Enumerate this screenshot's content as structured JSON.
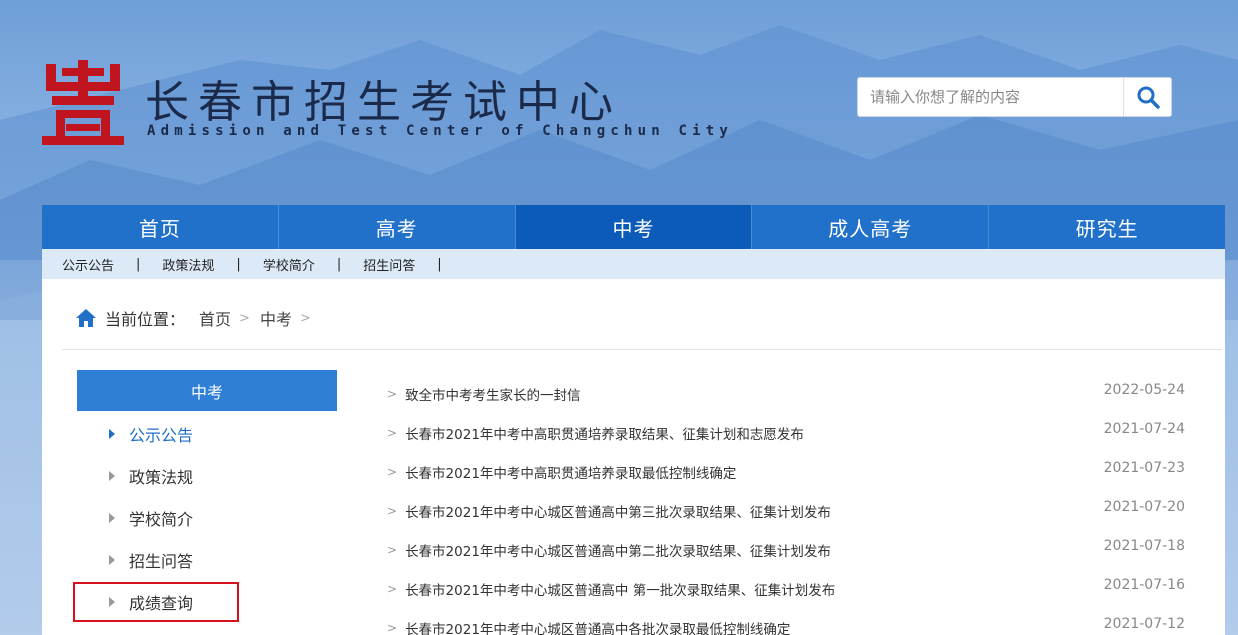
{
  "header": {
    "logo_icon": "changchun-logo-icon",
    "title": "长春市招生考试中心",
    "subtitle": "Admission and Test Center of Changchun City",
    "brand_color": "#c0151e"
  },
  "search": {
    "placeholder": "请输入你想了解的内容",
    "value": "",
    "button_icon": "search-icon"
  },
  "nav": {
    "items": [
      {
        "label": "首页"
      },
      {
        "label": "高考"
      },
      {
        "label": "中考"
      },
      {
        "label": "成人高考"
      },
      {
        "label": "研究生"
      }
    ],
    "active": "中考",
    "color": "#2170c9"
  },
  "subnav": {
    "items": [
      {
        "label": "公示公告"
      },
      {
        "label": "政策法规"
      },
      {
        "label": "学校简介"
      },
      {
        "label": "招生问答"
      }
    ],
    "separator": "|"
  },
  "breadcrumb": {
    "icon": "home-icon",
    "prefix": "当前位置：",
    "items": [
      {
        "label": "首页"
      },
      {
        "label": "中考"
      }
    ],
    "separator": ">"
  },
  "sidebar": {
    "header": "中考",
    "items": [
      {
        "label": "公示公告",
        "active": true
      },
      {
        "label": "政策法规",
        "active": false
      },
      {
        "label": "学校简介",
        "active": false
      },
      {
        "label": "招生问答",
        "active": false
      },
      {
        "label": "成绩查询",
        "active": false,
        "highlighted": true
      }
    ]
  },
  "news": {
    "items": [
      {
        "title": "致全市中考考生家长的一封信",
        "date": "2022-05-24"
      },
      {
        "title": "长春市2021年中考中高职贯通培养录取结果、征集计划和志愿发布",
        "date": "2021-07-24"
      },
      {
        "title": "长春市2021年中考中高职贯通培养录取最低控制线确定",
        "date": "2021-07-23"
      },
      {
        "title": "长春市2021年中考中心城区普通高中第三批次录取结果、征集计划发布",
        "date": "2021-07-20"
      },
      {
        "title": "长春市2021年中考中心城区普通高中第二批次录取结果、征集计划发布",
        "date": "2021-07-18"
      },
      {
        "title": "长春市2021年中考中心城区普通高中 第一批次录取结果、征集计划发布",
        "date": "2021-07-16"
      },
      {
        "title": "长春市2021年中考中心城区普通高中各批次录取最低控制线确定",
        "date": "2021-07-12"
      }
    ],
    "arrow": ">"
  }
}
